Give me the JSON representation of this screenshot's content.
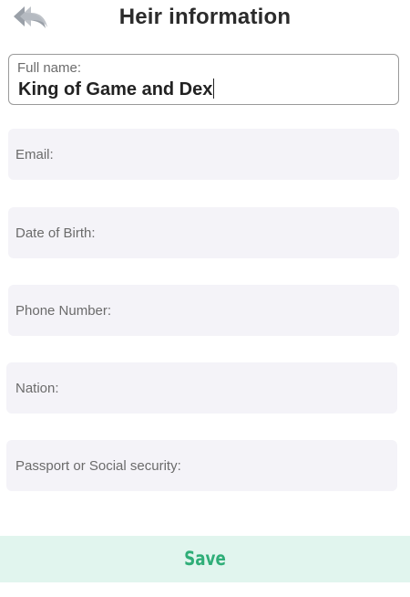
{
  "header": {
    "title": "Heir information",
    "back_icon": "double-back-arrow-icon"
  },
  "form": {
    "full_name": {
      "label": "Full name:",
      "value": "King of Game and Dex"
    },
    "email": {
      "label": "Email:"
    },
    "dob": {
      "label": "Date of Birth:"
    },
    "phone": {
      "label": "Phone Number:"
    },
    "nation": {
      "label": "Nation:"
    },
    "passport": {
      "label": "Passport or Social security:"
    }
  },
  "actions": {
    "save_label": "Save"
  },
  "colors": {
    "field_bg": "#f4f3f8",
    "save_bg": "#e1f5ee",
    "save_text": "#2fae78",
    "title_text": "#2b2b2b"
  }
}
